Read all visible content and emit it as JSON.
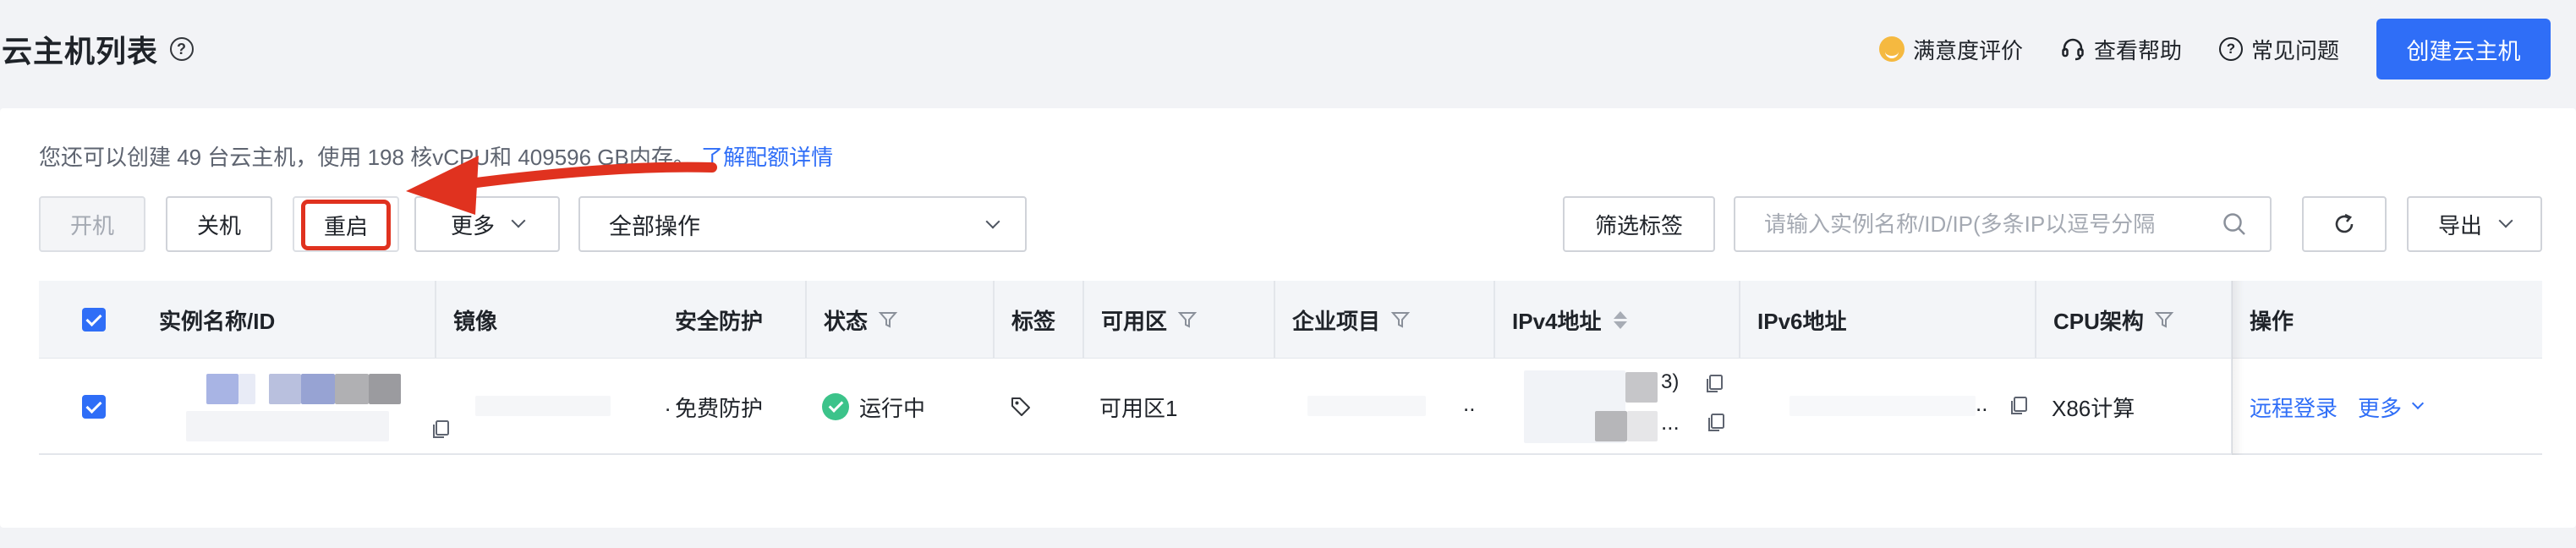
{
  "header": {
    "title": "云主机列表",
    "help_icon": "question-circle-icon",
    "links": [
      {
        "label": "满意度评价",
        "icon": "smile-icon"
      },
      {
        "label": "查看帮助",
        "icon": "headset-icon"
      },
      {
        "label": "常见问题",
        "icon": "question-circle-icon"
      }
    ],
    "create_button": "创建云主机"
  },
  "quota": {
    "text": "您还可以创建 49 台云主机，使用 198 核vCPU和 409596 GB内存。",
    "link": "了解配额详情"
  },
  "toolbar": {
    "power_on": "开机",
    "power_off": "关机",
    "reboot": "重启",
    "more": "更多",
    "all_actions": "全部操作",
    "filter_tags": "筛选标签",
    "search_placeholder": "请输入实例名称/ID/IP(多条IP以逗号分隔",
    "export": "导出"
  },
  "table": {
    "columns": [
      "实例名称/ID",
      "镜像",
      "安全防护",
      "状态",
      "标签",
      "可用区",
      "企业项目",
      "IPv4地址",
      "IPv6地址",
      "CPU架构",
      "操作"
    ],
    "row": {
      "image_suffix": ".",
      "security": "免费防护",
      "status": "运行中",
      "zone": "可用区1",
      "project_suffix": "..",
      "ipv4_line1_suffix": "3)",
      "ipv4_line2_suffix": "...",
      "ipv6_suffix": "..",
      "cpu": "X86计算",
      "action_remote": "远程登录",
      "action_more": "更多"
    }
  },
  "colors": {
    "primary": "#2f6ef7",
    "annotation": "#e0321f",
    "status_running": "#3cc38a"
  }
}
